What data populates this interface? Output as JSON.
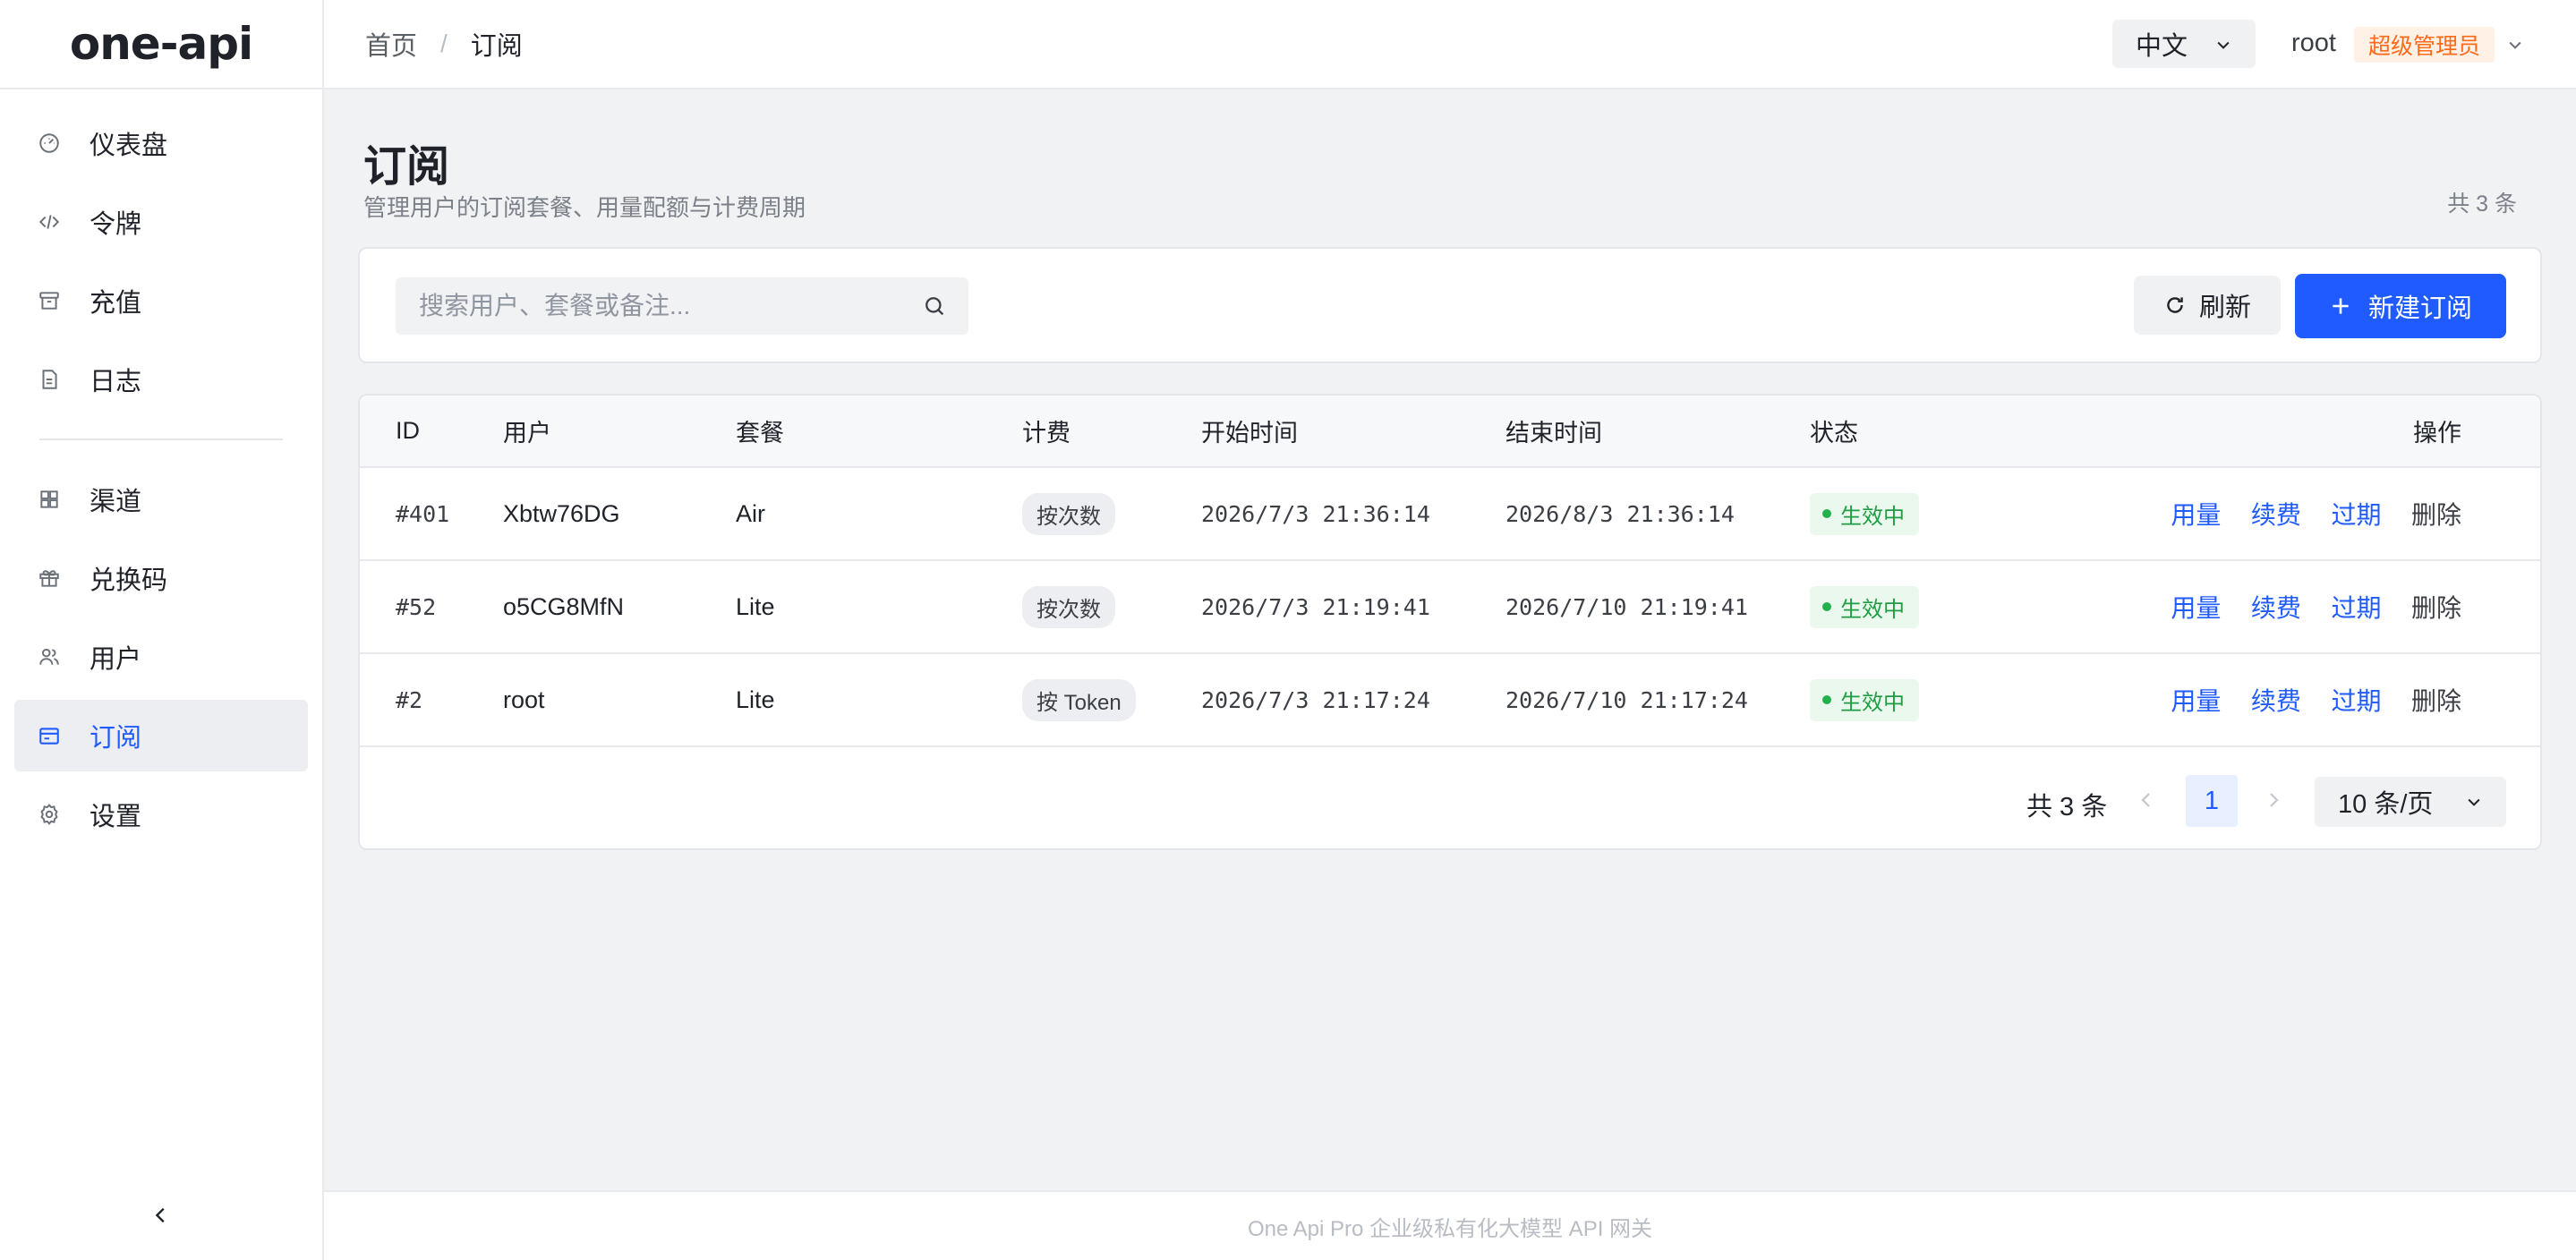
{
  "app": {
    "logo_text": "one-api"
  },
  "colors": {
    "accent": "#1f5bff",
    "badge_orange": "#ff6a1a",
    "status_green": "#1f9d45"
  },
  "sidebar": {
    "items": [
      {
        "label": "仪表盘",
        "icon": "dashboard-icon"
      },
      {
        "label": "令牌",
        "icon": "code-icon"
      },
      {
        "label": "充值",
        "icon": "archive-icon"
      },
      {
        "label": "日志",
        "icon": "document-icon"
      },
      {
        "label": "渠道",
        "icon": "grid-icon"
      },
      {
        "label": "兑换码",
        "icon": "gift-icon"
      },
      {
        "label": "用户",
        "icon": "users-icon"
      },
      {
        "label": "订阅",
        "icon": "subscription-icon",
        "active": true
      },
      {
        "label": "设置",
        "icon": "gear-icon"
      }
    ]
  },
  "header": {
    "breadcrumb": {
      "home": "首页",
      "separator": "/",
      "current": "订阅"
    },
    "language": "中文",
    "user_name": "root",
    "role_badge": "超级管理员"
  },
  "main": {
    "title": "订阅",
    "subtitle": "管理用户的订阅套餐、用量配额与计费周期",
    "total_top": "共 3 条",
    "search_placeholder": "搜索用户、套餐或备注...",
    "refresh_label": "刷新",
    "new_label": "新建订阅"
  },
  "table": {
    "columns": [
      "ID",
      "用户",
      "套餐",
      "计费",
      "开始时间",
      "结束时间",
      "状态",
      "操作"
    ],
    "rows": [
      {
        "id": "#401",
        "user": "Xbtw76DG",
        "plan": "Air",
        "billing": "按次数",
        "start": "2026/7/3 21:36:14",
        "end": "2026/8/3 21:36:14",
        "status": "生效中"
      },
      {
        "id": "#52",
        "user": "o5CG8MfN",
        "plan": "Lite",
        "billing": "按次数",
        "start": "2026/7/3 21:19:41",
        "end": "2026/7/10 21:19:41",
        "status": "生效中"
      },
      {
        "id": "#2",
        "user": "root",
        "plan": "Lite",
        "billing": "按 Token",
        "start": "2026/7/3 21:17:24",
        "end": "2026/7/10 21:17:24",
        "status": "生效中"
      }
    ],
    "actions": {
      "usage": "用量",
      "renew": "续费",
      "expire": "过期",
      "delete": "删除"
    }
  },
  "pagination": {
    "total": "共 3 条",
    "current_page": "1",
    "page_size": "10 条/页"
  },
  "footer": {
    "text": "One Api Pro 企业级私有化大模型 API 网关"
  }
}
